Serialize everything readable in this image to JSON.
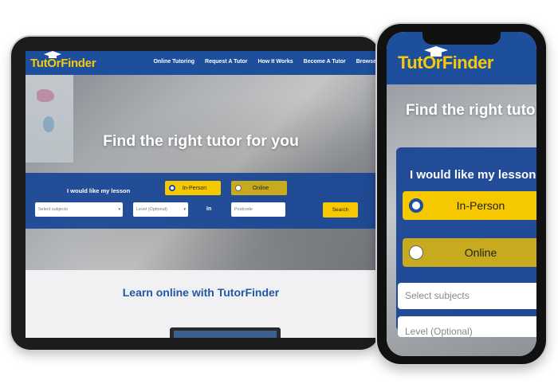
{
  "brand": {
    "name": "TutOrFinder",
    "accent": "#f6c90e",
    "primary": "#1d4f9c"
  },
  "tablet": {
    "nav": [
      "Online Tutoring",
      "Request A Tutor",
      "How It Works",
      "Become A Tutor",
      "Browse"
    ],
    "headline": "Find the right tutor for you",
    "lesson_label": "I would like my lesson",
    "option_inperson": "In-Person",
    "option_online": "Online",
    "subjects_placeholder": "Select subjects",
    "level_placeholder": "Level (Optional)",
    "in_label": "In",
    "postcode_placeholder": "Postcode",
    "search_label": "Search",
    "learn_heading": "Learn online with TutorFinder"
  },
  "phone": {
    "headline": "Find the right tutor for you",
    "lesson_label": "I would like my lesson",
    "option_inperson": "In-Person",
    "option_online": "Online",
    "subjects_placeholder": "Select subjects",
    "level_placeholder": "Level (Optional)"
  }
}
